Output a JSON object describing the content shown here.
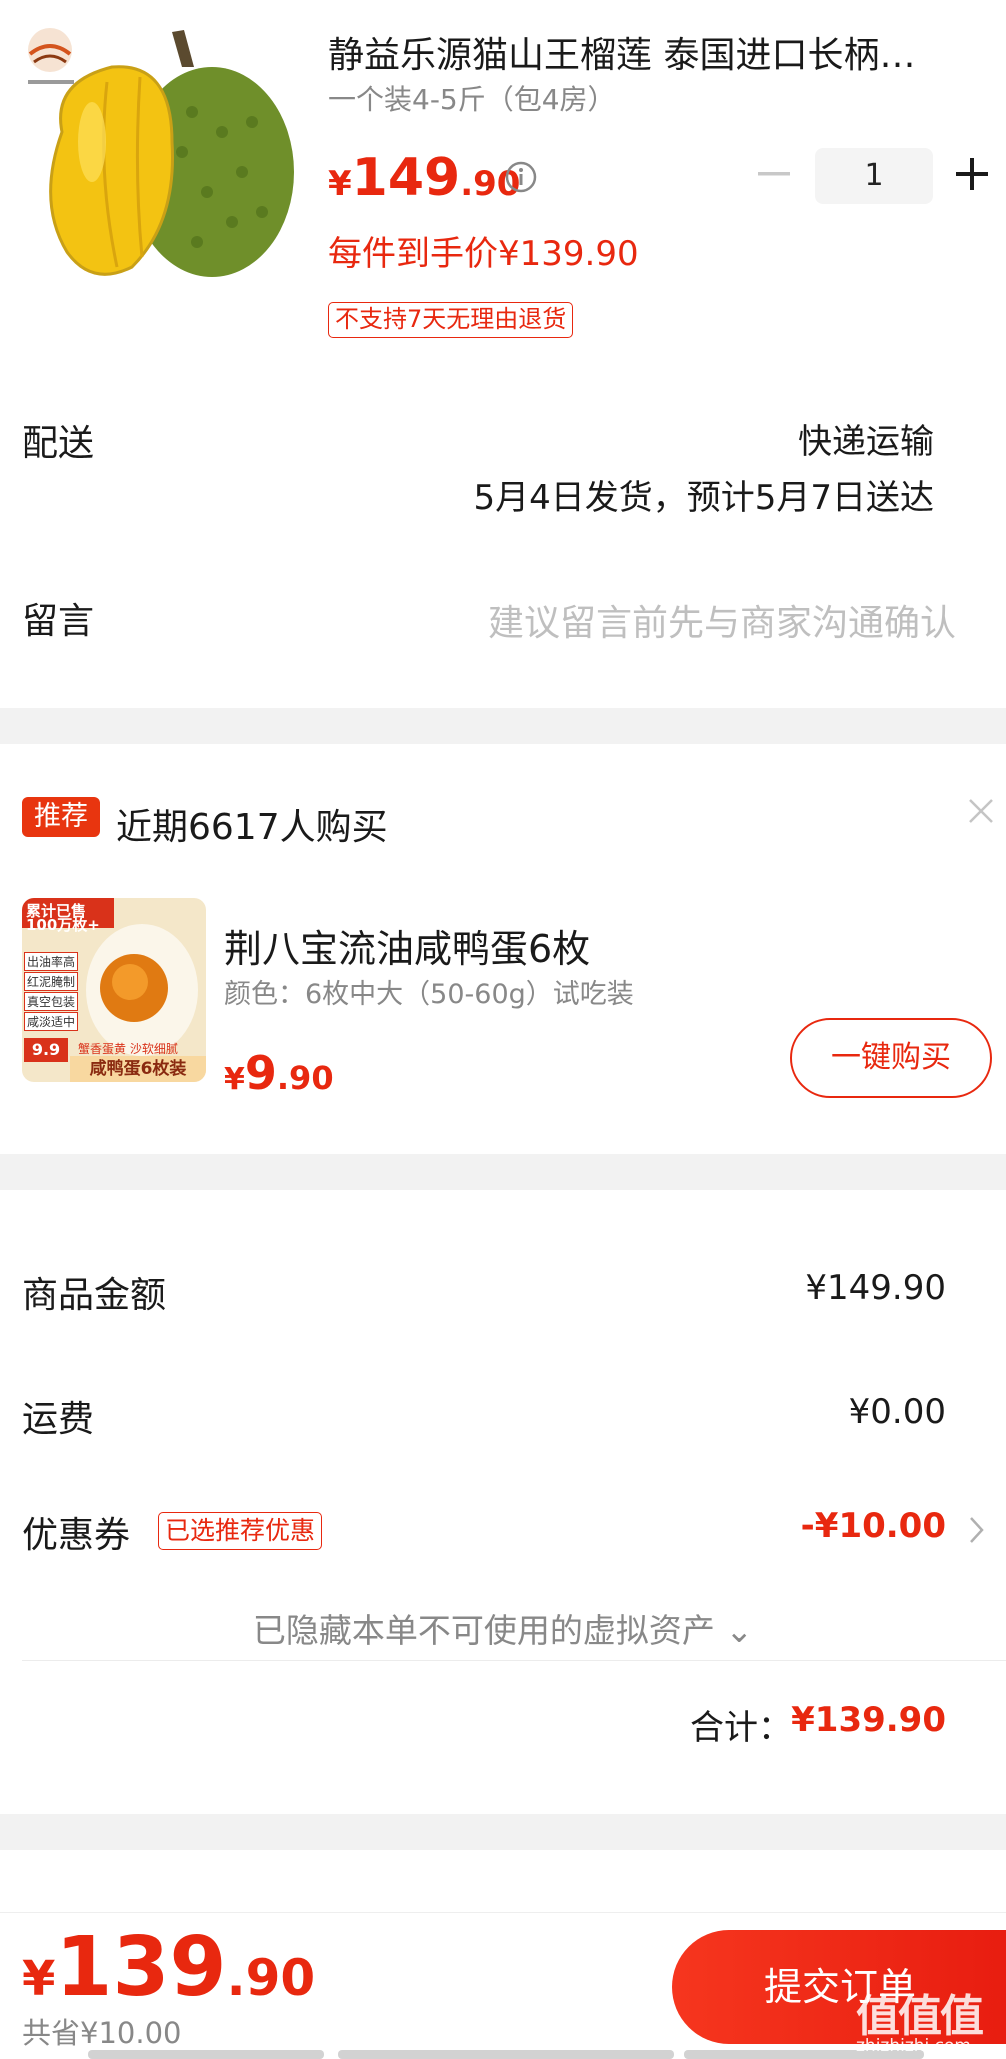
{
  "product": {
    "title": "静益乐源猫山王榴莲 泰国进口长柄…",
    "spec": "一个装4-5斤（包4房）",
    "price_currency": "¥",
    "price_int": "149",
    "price_dec": ".90",
    "net_price": "每件到手价¥139.90",
    "quantity": "1",
    "return_policy": "不支持7天无理由退货",
    "logo_icon": "brand-logo-icon"
  },
  "delivery": {
    "label": "配送",
    "method": "快递运输",
    "time": "5月4日发货，预计5月7日送达"
  },
  "message": {
    "label": "留言",
    "placeholder": "建议留言前先与商家沟通确认"
  },
  "recommend": {
    "badge": "推荐",
    "text": "近期6617人购买",
    "item": {
      "title": "荆八宝流油咸鸭蛋6枚",
      "spec": "颜色：6枚中大（50-60g）试吃装",
      "price_currency": "¥",
      "price_int": "9",
      "price_dec": ".90",
      "buy_label": "一键购买",
      "image_text": {
        "banner": "累计已售",
        "banner2": "100万枚+",
        "tags": [
          "出油率高",
          "红泥腌制",
          "真空包装",
          "咸淡适中"
        ],
        "small_price": "9.9",
        "caption_top": "蟹香蛋黄 沙软细腻",
        "caption": "咸鸭蛋6枚装"
      }
    }
  },
  "summary": {
    "goods_label": "商品金额",
    "goods_value": "¥149.90",
    "shipping_label": "运费",
    "shipping_value": "¥0.00",
    "coupon_label": "优惠券",
    "coupon_badge": "已选推荐优惠",
    "coupon_value": "-¥10.00",
    "hidden_note": "已隐藏本单不可使用的虚拟资产 ⌄",
    "total_label": "合计：",
    "total_value": "¥139.90"
  },
  "bottom": {
    "pay_currency": "¥",
    "pay_int": "139",
    "pay_dec": ".90",
    "saved": "共省¥10.00",
    "submit_label": "提交订单",
    "watermark_main": "值值值",
    "watermark_sub": "zhizhizhi.com"
  },
  "colors": {
    "accent": "#e8280f",
    "muted": "#888888",
    "gap": "#f2f2f2"
  }
}
